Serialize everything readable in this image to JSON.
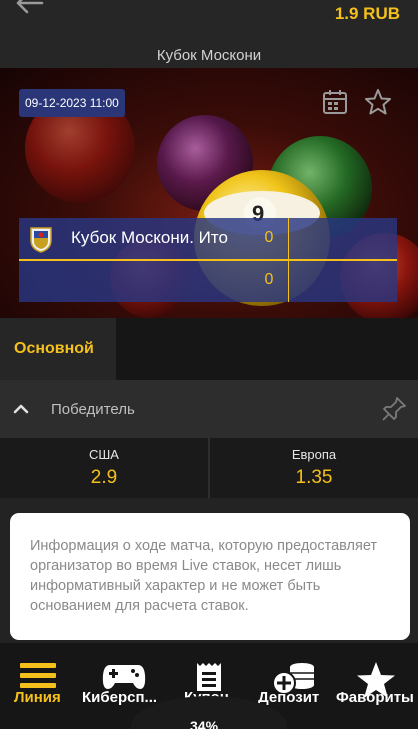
{
  "header": {
    "balance": "1.9 RUB"
  },
  "title": "Кубок Москони",
  "match": {
    "date": "09-12-2023 11:00",
    "team1": "Кубок Москони. Ито",
    "score1": "0",
    "score2": "0"
  },
  "tabs": {
    "main": "Основной"
  },
  "market": {
    "title": "Победитель",
    "outcomes": [
      {
        "name": "США",
        "odd": "2.9"
      },
      {
        "name": "Европа",
        "odd": "1.35"
      }
    ]
  },
  "info": {
    "text": "Информация о ходе матча, которую предоставляет организатор во время Live ставок, несет лишь информативный характер и не может быть основанием для расчета ставок."
  },
  "nav": {
    "items": [
      {
        "label": "Линия",
        "icon": "lines-icon"
      },
      {
        "label": "Киберсп...",
        "icon": "gamepad-icon"
      },
      {
        "label": "Купон",
        "icon": "coupon-icon"
      },
      {
        "label": "Депозит",
        "icon": "coins-icon"
      },
      {
        "label": "Фавориты",
        "icon": "star-icon"
      }
    ],
    "bottom_partial": "34%"
  },
  "colors": {
    "accent": "#f5c01c",
    "badge": "#2a3678",
    "scoreboard": "#283782"
  }
}
